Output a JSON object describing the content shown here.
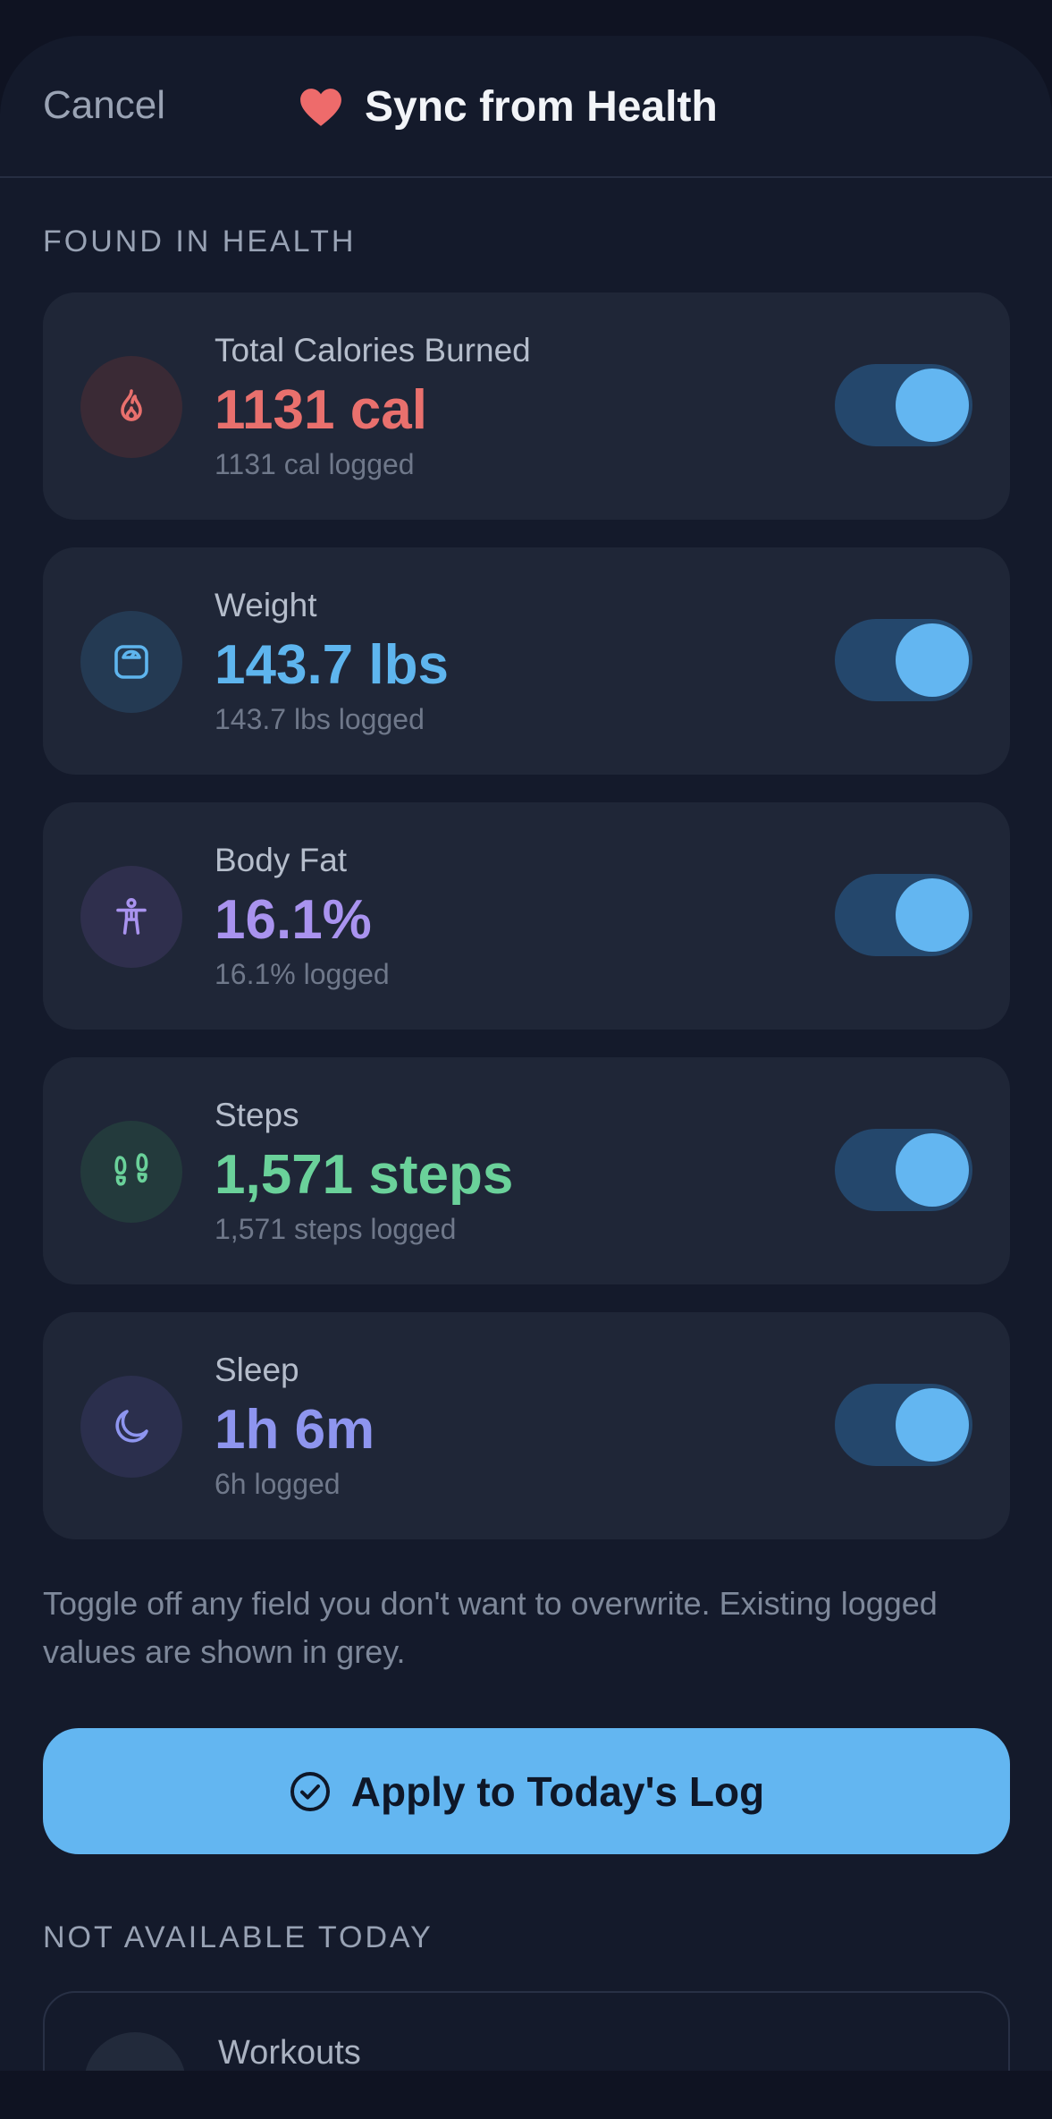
{
  "header": {
    "cancel_label": "Cancel",
    "title": "Sync from Health",
    "title_icon": "heart-icon"
  },
  "sections": {
    "found": "FOUND IN HEALTH",
    "not_available": "NOT AVAILABLE TODAY"
  },
  "metrics": [
    {
      "label": "Total Calories Burned",
      "value": "1131 cal",
      "logged": "1131 cal logged",
      "icon": "flame-icon",
      "color": "#e9706d",
      "enabled": true
    },
    {
      "label": "Weight",
      "value": "143.7 lbs",
      "logged": "143.7 lbs logged",
      "icon": "scale-icon",
      "color": "#5eb5ee",
      "enabled": true
    },
    {
      "label": "Body Fat",
      "value": "16.1%",
      "logged": "16.1% logged",
      "icon": "body-icon",
      "color": "#a993ef",
      "enabled": true
    },
    {
      "label": "Steps",
      "value": "1,571 steps",
      "logged": "1,571 steps logged",
      "icon": "footprints-icon",
      "color": "#6ad19a",
      "enabled": true
    },
    {
      "label": "Sleep",
      "value": "1h 6m",
      "logged": "6h logged",
      "icon": "moon-icon",
      "color": "#8e95ef",
      "enabled": true
    }
  ],
  "note": "Toggle off any field you don't want to overwrite. Existing logged values are shown in grey.",
  "apply_button": {
    "label": "Apply to Today's Log",
    "icon": "check-circle-icon"
  },
  "unavailable": [
    {
      "label": "Workouts",
      "icon": "workout-icon"
    }
  ],
  "colors": {
    "accent": "#63b6f1",
    "toggle_track": "#24476c",
    "card_bg": "#1f2637",
    "page_bg": "#141a2b"
  }
}
